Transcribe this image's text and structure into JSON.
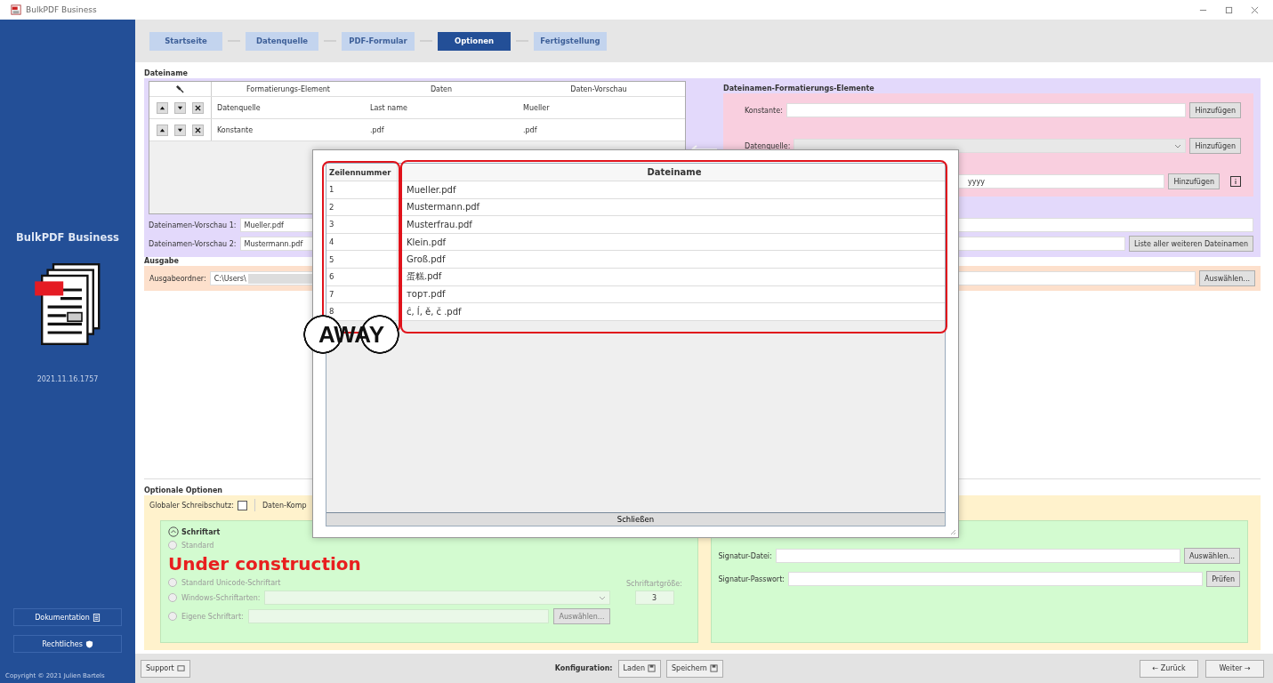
{
  "window": {
    "title": "BulkPDF Business"
  },
  "sidebar": {
    "app_name": "BulkPDF Business",
    "version": "2021.11.16.1757",
    "buttons": [
      {
        "label": "Dokumentation",
        "kind": "doc"
      },
      {
        "label": "Rechtliches",
        "kind": "legal"
      }
    ],
    "copyright": "Copyright © 2021 Julien Bartels"
  },
  "steps": [
    {
      "label": "Startseite",
      "selected": false
    },
    {
      "label": "Datenquelle",
      "selected": false
    },
    {
      "label": "PDF-Formular",
      "selected": false
    },
    {
      "label": "Optionen",
      "selected": true
    },
    {
      "label": "Fertigstellung",
      "selected": false
    }
  ],
  "filename": {
    "title": "Dateiname",
    "columns": [
      "Formatierungs-Element",
      "Daten",
      "Daten-Vorschau"
    ],
    "rows": [
      [
        "Datenquelle",
        "Last name",
        "Mueller"
      ],
      [
        "Konstante",
        ".pdf",
        ".pdf"
      ]
    ],
    "previews": [
      {
        "label": "Dateinamen-Vorschau 1:",
        "value": "Mueller.pdf"
      },
      {
        "label": "Dateinamen-Vorschau 2:",
        "value": "Mustermann.pdf"
      }
    ],
    "list_button": "Liste aller weiteren Dateinamen"
  },
  "format_elements": {
    "title": "Dateinamen-Formatierungs-Elemente",
    "rows": [
      {
        "kind": "text",
        "label": "Konstante:",
        "button": "Hinzufügen"
      },
      {
        "kind": "dropdown",
        "label": "Datenquelle:",
        "button": "Hinzufügen"
      },
      {
        "kind": "date",
        "value": "yyyy",
        "button": "Hinzufügen"
      }
    ]
  },
  "output": {
    "title": "Ausgabe",
    "label": "Ausgabeordner:",
    "value": "C:\\Users\\",
    "button": "Auswählen..."
  },
  "options": {
    "title": "Optionale Optionen",
    "write_protect": {
      "label": "Globaler Schreibschutz:",
      "checked": false
    },
    "compression_label": "Daten-Komp",
    "font": {
      "title": "Schriftart",
      "expanded": true,
      "notice": "Under construction",
      "options": [
        {
          "label": "Standard",
          "selected": false,
          "kind": "plain"
        },
        {
          "label": "Standard Unicode-Schriftart",
          "selected": false,
          "kind": "plain"
        },
        {
          "label": "Windows-Schriftarten:",
          "selected": false,
          "kind": "dropdown"
        },
        {
          "label": "Eigene Schriftart:",
          "selected": false,
          "kind": "file",
          "button": "Auswählen..."
        }
      ],
      "size_label": "Schriftartgröße:",
      "size_value": "3"
    },
    "signature": {
      "file_label": "Signatur-Datei:",
      "file_button": "Auswählen...",
      "password_label": "Signatur-Passwort:",
      "password_button": "Prüfen"
    }
  },
  "footer": {
    "support": "Support",
    "config_label": "Konfiguration:",
    "load": "Laden",
    "save": "Speichern",
    "back": "← Zurück",
    "next": "Weiter →"
  },
  "dialog": {
    "columns": [
      "Zeilennummer",
      "Dateiname"
    ],
    "rows": [
      [
        "1",
        "Mueller.pdf"
      ],
      [
        "2",
        "Mustermann.pdf"
      ],
      [
        "3",
        "Musterfrau.pdf"
      ],
      [
        "4",
        "Klein.pdf"
      ],
      [
        "5",
        "Groß.pdf"
      ],
      [
        "6",
        "蛋糕.pdf"
      ],
      [
        "7",
        "торт.pdf"
      ],
      [
        "8",
        "ĉ, ĺ, ě, č .pdf"
      ]
    ],
    "close": "Schließen",
    "annotation": "AWAY"
  }
}
